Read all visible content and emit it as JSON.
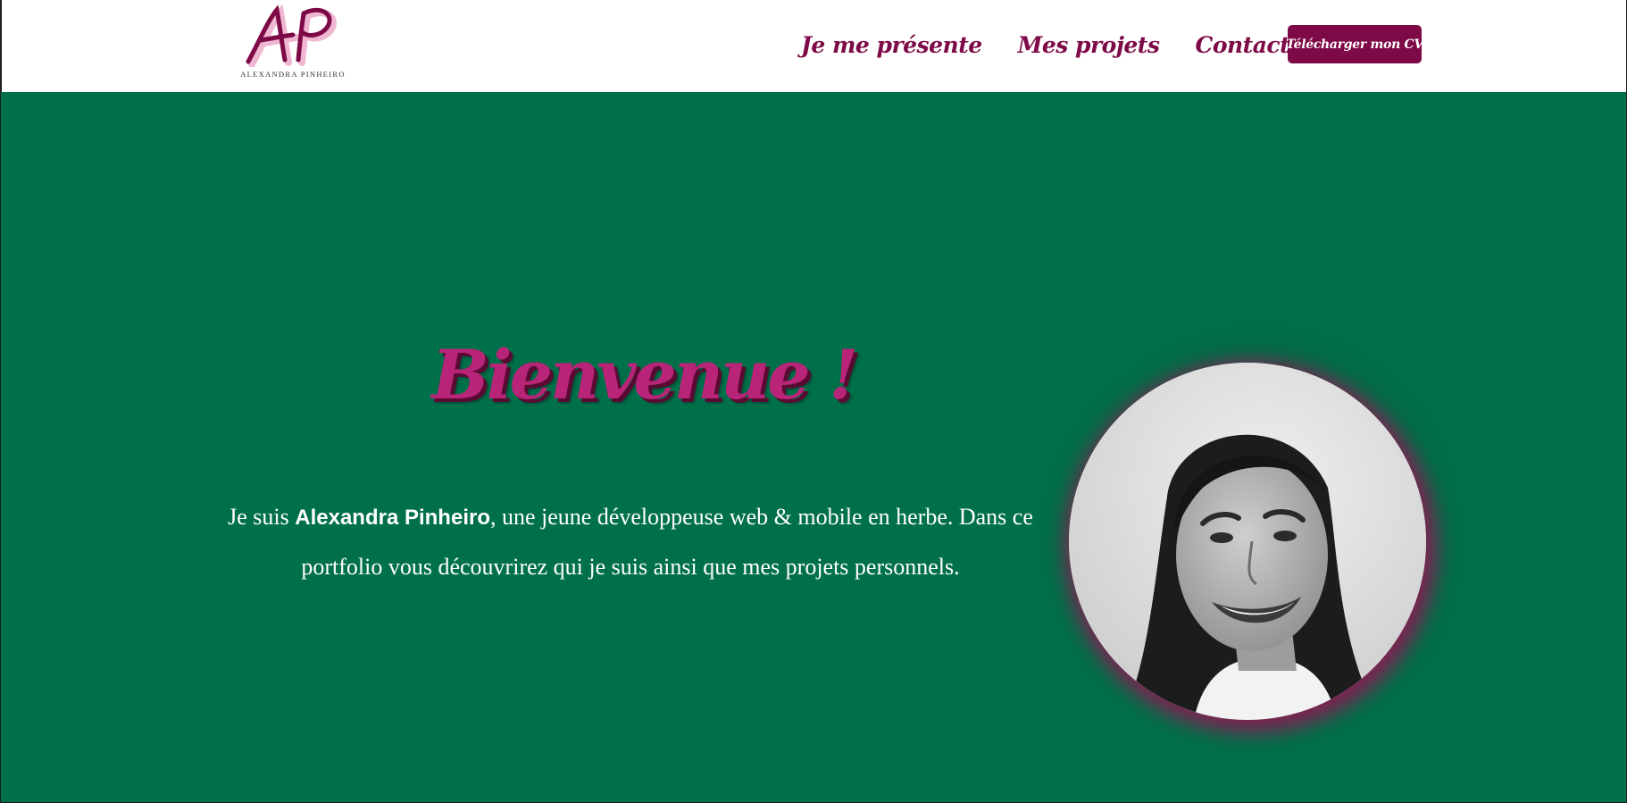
{
  "brand": {
    "monogram": "AP",
    "name": "ALEXANDRA PINHEIRO"
  },
  "nav": {
    "items": [
      {
        "label": "Je me présente"
      },
      {
        "label": "Mes projets"
      },
      {
        "label": "Contact"
      }
    ],
    "cv_button_label": "Télécharger mon CV"
  },
  "hero": {
    "title": "Bienvenue !",
    "intro_before": "Je suis ",
    "intro_name": "Alexandra Pinheiro",
    "intro_after": ", une jeune développeuse web & mobile en herbe. Dans ce portfolio vous découvrirez qui je suis ainsi que mes projets personnels."
  },
  "colors": {
    "brand_burgundy": "#7d0a46",
    "title_pink": "#b82478",
    "hero_green": "#00704a",
    "text_white": "#ffffff"
  }
}
